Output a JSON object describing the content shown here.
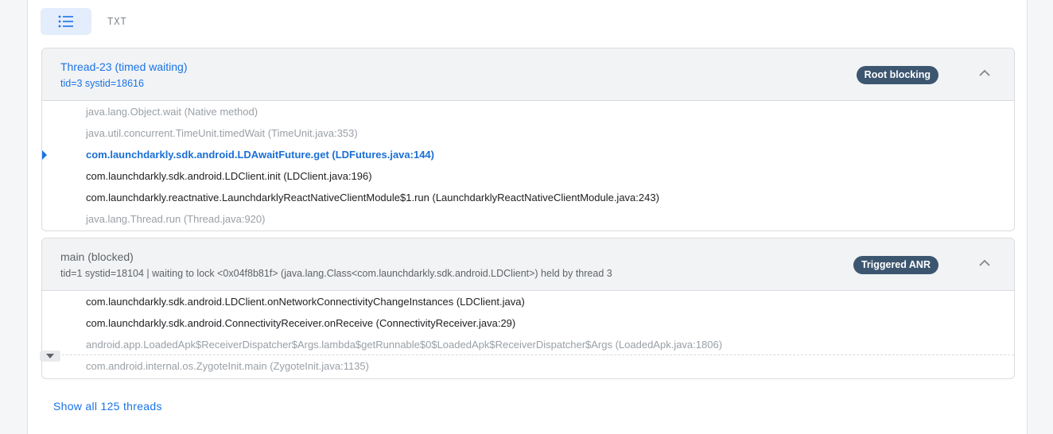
{
  "toolbar": {
    "list_view_icon": "list-icon",
    "txt_label": "TXT"
  },
  "threads": [
    {
      "name": "Thread-23 (timed waiting)",
      "sub": "tid=3 systid=18616",
      "badge": "Root blocking",
      "frames": [
        {
          "text": "java.lang.Object.wait (Native method)",
          "style": "dim"
        },
        {
          "text": "java.util.concurrent.TimeUnit.timedWait (TimeUnit.java:353)",
          "style": "dim"
        },
        {
          "text": "com.launchdarkly.sdk.android.LDAwaitFuture.get (LDFutures.java:144)",
          "style": "highlighted"
        },
        {
          "text": "com.launchdarkly.sdk.android.LDClient.init (LDClient.java:196)",
          "style": "normal"
        },
        {
          "text": "com.launchdarkly.reactnative.LaunchdarklyReactNativeClientModule$1.run (LaunchdarklyReactNativeClientModule.java:243)",
          "style": "normal"
        },
        {
          "text": "java.lang.Thread.run (Thread.java:920)",
          "style": "dim"
        }
      ]
    },
    {
      "name": "main (blocked)",
      "sub": "tid=1 systid=18104 | waiting to lock <0x04f8b81f> (java.lang.Class<com.launchdarkly.sdk.android.LDClient>) held by thread 3",
      "badge": "Triggered ANR",
      "frames": [
        {
          "text": "com.launchdarkly.sdk.android.LDClient.onNetworkConnectivityChangeInstances (LDClient.java)",
          "style": "normal"
        },
        {
          "text": "com.launchdarkly.sdk.android.ConnectivityReceiver.onReceive (ConnectivityReceiver.java:29)",
          "style": "normal"
        },
        {
          "text": "android.app.LoadedApk$ReceiverDispatcher$Args.lambda$getRunnable$0$LoadedApk$ReceiverDispatcher$Args (LoadedApk.java:1806)",
          "style": "dim"
        },
        {
          "text": "com.android.internal.os.ZygoteInit.main (ZygoteInit.java:1135)",
          "style": "dim"
        }
      ]
    }
  ],
  "show_all": "Show all 125 threads",
  "colors": {
    "accent": "#1a73e8",
    "badge_bg": "#3d5670",
    "header_bg": "#f1f3f4"
  }
}
